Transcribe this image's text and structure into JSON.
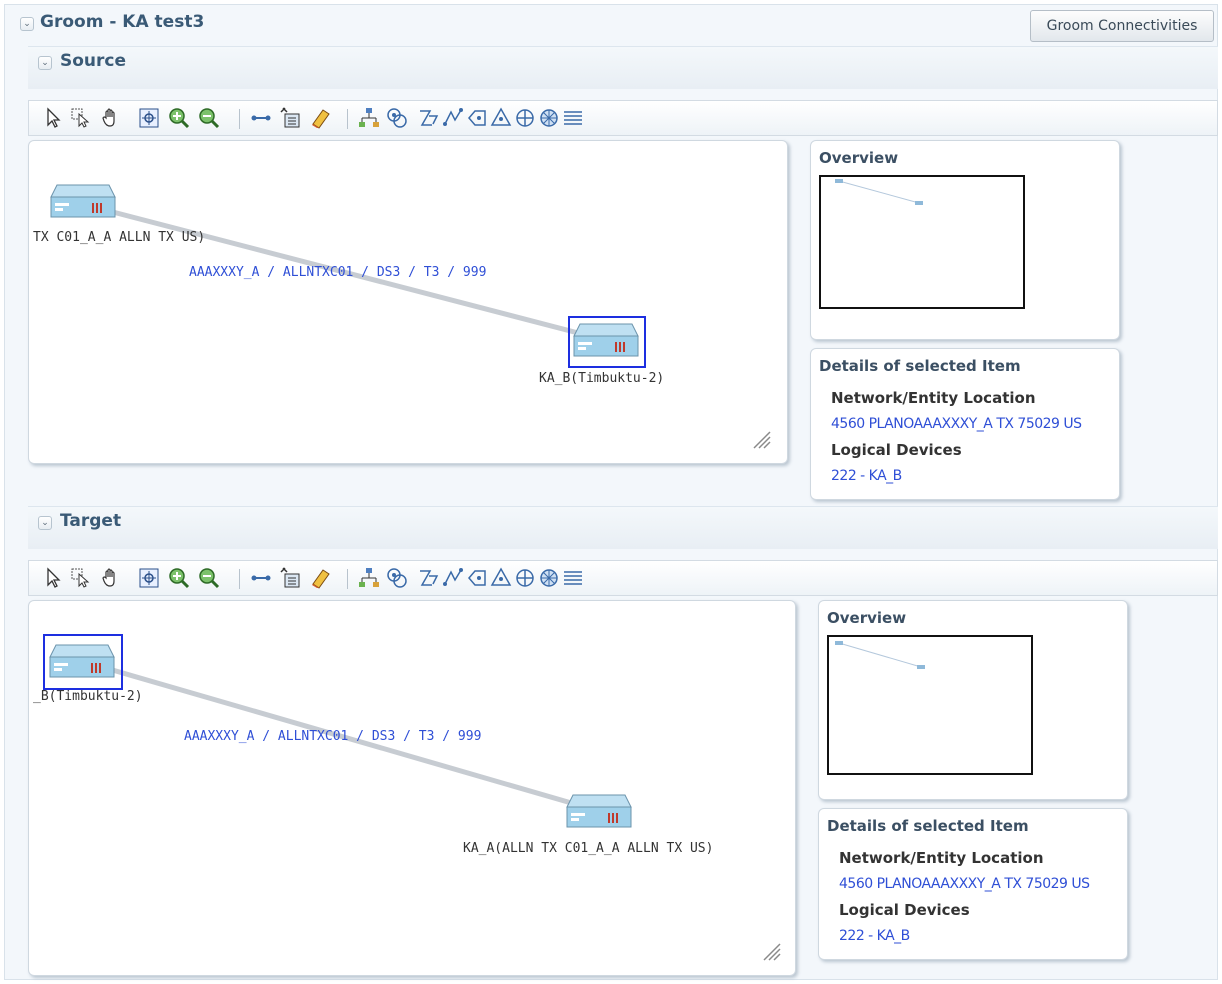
{
  "header": {
    "title": "Groom - KA test3",
    "groom_button_label": "Groom Connectivities"
  },
  "toolbar_icons": [
    "select-icon",
    "marquee-select-icon",
    "pan-hand-icon",
    "zoom-fit-icon",
    "zoom-in-icon",
    "zoom-out-icon",
    "link-icon",
    "add-node-icon",
    "eraser-icon",
    "hierarchy-layout-icon",
    "group-layout-icon",
    "layout-icon-1",
    "layout-icon-2",
    "layout-icon-3",
    "layout-icon-4",
    "layout-icon-5",
    "layout-icon-6",
    "list-icon"
  ],
  "source": {
    "title": "Source",
    "node_a_label": "TX C01_A_A ALLN TX  US)",
    "node_b_label": "KA_B(Timbuktu-2)",
    "link_label": "AAAXXXY_A / ALLNTXC01 / DS3 / T3 / 999",
    "overview_title": "Overview",
    "details": {
      "title": "Details of selected Item",
      "location_heading": "Network/Entity Location",
      "location_value": "4560 PLANOAAAXXXY_A TX 75029 US",
      "devices_heading": "Logical Devices",
      "devices_value": "222 - KA_B"
    }
  },
  "target": {
    "title": "Target",
    "node_a_label": "_B(Timbuktu-2)",
    "node_b_label": "KA_A(ALLN TX C01_A_A ALLN TX  US)",
    "link_label": "AAAXXXY_A / ALLNTXC01 / DS3 / T3 / 999",
    "overview_title": "Overview",
    "details": {
      "title": "Details of selected Item",
      "location_heading": "Network/Entity Location",
      "location_value": "4560 PLANOAAAXXXY_A TX 75029 US",
      "devices_heading": "Logical Devices",
      "devices_value": "222 - KA_B"
    }
  },
  "colors": {
    "link_text": "#2f4fd6",
    "selection": "#1d2fe0",
    "title": "#3a5a76"
  }
}
